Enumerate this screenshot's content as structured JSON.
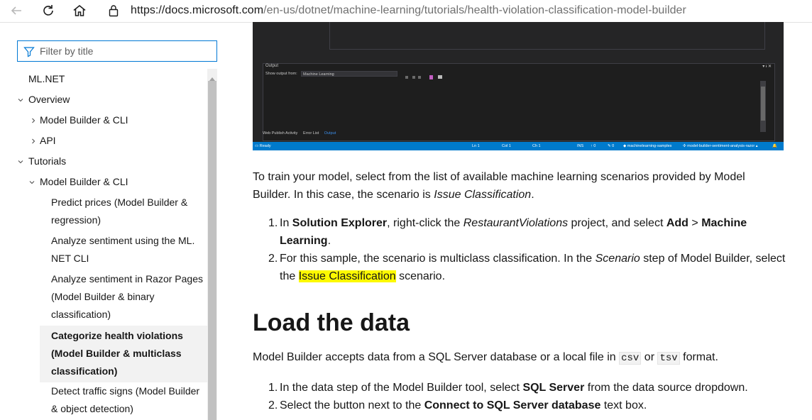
{
  "browser": {
    "url_host": "https://docs.microsoft.com",
    "url_path": "/en-us/dotnet/machine-learning/tutorials/health-violation-classification-model-builder"
  },
  "sidebar": {
    "filter_placeholder": "Filter by title",
    "items": [
      {
        "label": "ML.NET"
      },
      {
        "label": "Overview"
      },
      {
        "label": "Model Builder & CLI"
      },
      {
        "label": "API"
      },
      {
        "label": "Tutorials"
      },
      {
        "label": "Model Builder & CLI"
      },
      {
        "line1": "Predict prices (Model Builder &",
        "line2": "regression)"
      },
      {
        "line1": "Analyze sentiment using the ML.",
        "line2": "NET CLI"
      },
      {
        "line1": "Analyze sentiment in Razor Pages",
        "line2": "(Model Builder & binary",
        "line3": "classification)"
      },
      {
        "line1": "Categorize health violations",
        "line2": "(Model Builder & multiclass",
        "line3": "classification)"
      },
      {
        "line1": "Detect traffic signs (Model Builder",
        "line2": "& object detection)"
      }
    ]
  },
  "vs_screenshot": {
    "output_title": "Output",
    "output_tools": "▾ ᵻ ✕",
    "show_output_from": "Show output from:",
    "source": "Machine Learning",
    "tabs": [
      "Web Publish Activity",
      "Error List",
      "Output"
    ],
    "status": {
      "ready": "Ready",
      "ln": "Ln 1",
      "col": "Col 1",
      "ch": "Ch 1",
      "ins": "INS",
      "up": "↑ 0",
      "pen": "✎ 0",
      "repo": "◆ machinelearning-samples",
      "branch": "✣ model-builder-sentiment-analysis-razor ▴",
      "bell": "🔔"
    }
  },
  "article": {
    "intro_1": "To train your model, select from the list of available machine learning scenarios provided by Model",
    "intro_2a": "Builder. In this case, the scenario is ",
    "intro_2b": "Issue Classification",
    "intro_2c": ".",
    "step1": {
      "num": "1.",
      "a": "In ",
      "b": "Solution Explorer",
      "c": ", right-click the ",
      "d": "RestaurantViolations",
      "e": " project, and select ",
      "f": "Add",
      "g": " > ",
      "h": "Machine",
      "i": "Learning",
      "j": "."
    },
    "step2": {
      "num": "2.",
      "a": "For this sample, the scenario is multiclass classification. In the ",
      "b": "Scenario",
      "c": " step of Model Builder, select",
      "d": "the ",
      "e": "Issue Classification",
      "f": " scenario."
    },
    "heading": "Load the data",
    "load_a": "Model Builder accepts data from a SQL Server database or a local file in ",
    "load_csv": "csv",
    "load_or": " or ",
    "load_tsv": "tsv",
    "load_b": " format.",
    "data_step1": {
      "num": "1.",
      "a": "In the data step of the Model Builder tool, select ",
      "b": "SQL Server",
      "c": " from the data source dropdown."
    },
    "data_step2": {
      "num": "2.",
      "a": "Select the button next to the ",
      "b": "Connect to SQL Server database",
      "c": " text box."
    }
  }
}
